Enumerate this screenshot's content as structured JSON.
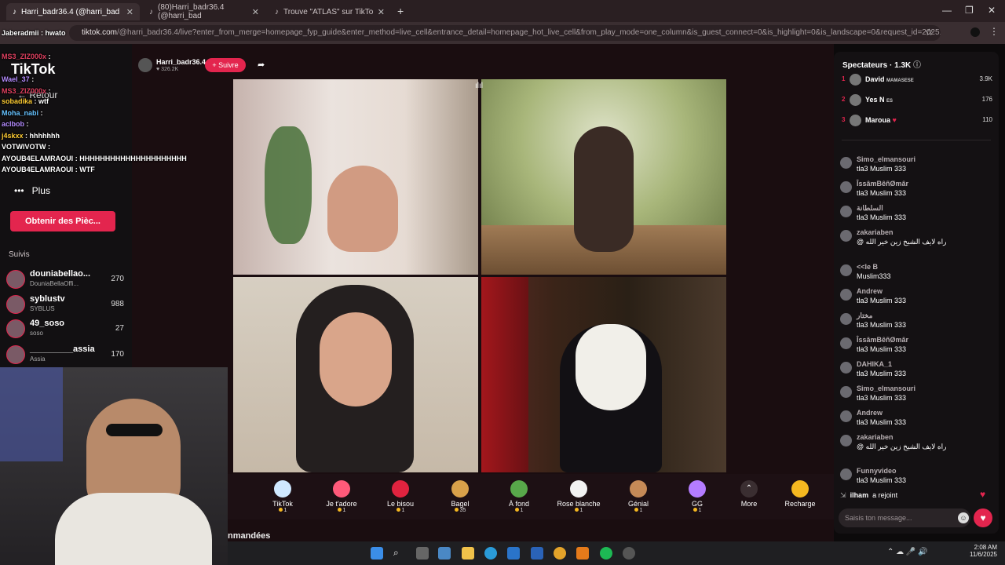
{
  "browser": {
    "tabs": [
      {
        "title": "Harri_badr36.4 (@harri_bad",
        "active": true
      },
      {
        "title": "(80)Harri_badr36.4 (@harri_bad",
        "active": false
      },
      {
        "title": "Trouve \"ATLAS\" sur TikTok | Rec",
        "active": false
      }
    ],
    "url_host": "tiktok.com",
    "url_path": "/@harri_badr36.4/live?enter_from_merge=homepage_fyp_guide&enter_method=live_cell&entrance_detail=homepage_hot_live_cell&from_play_mode=one_column&is_guest_connect=0&is_highlight=0&is_landscape=0&request_id=202511060811..."
  },
  "sidebar": {
    "logo": "TikTok",
    "back": "Retour",
    "more": "Plus",
    "coins_button": "Obtenir des Pièc...",
    "following_title": "Suivis",
    "following": [
      {
        "name": "douniabellao...",
        "sub": "DouniaBellaOffi...",
        "count": "270"
      },
      {
        "name": "syblustv",
        "sub": "SYBLUS",
        "count": "988"
      },
      {
        "name": "49_soso",
        "sub": "soso",
        "count": "27"
      },
      {
        "name": "_________assia",
        "sub": "Assia",
        "count": "170"
      }
    ]
  },
  "overlay_chat": [
    {
      "user": "Jaberadmii",
      "msg": ": hwato",
      "color": "#ffffff"
    },
    {
      "user": "MS3_ZIZ000x",
      "msg": ":",
      "color": "#e04060"
    },
    {
      "user": "Wael_37",
      "msg": ":",
      "color": "#b58cff"
    },
    {
      "user": "MS3_ZIZ000x",
      "msg": ":",
      "color": "#e04060"
    },
    {
      "user": "sobadika",
      "msg": ": wtf",
      "color": "#ffcc33"
    },
    {
      "user": "Moha_nabi",
      "msg": ":",
      "color": "#66c2ff"
    },
    {
      "user": "aclbob",
      "msg": ":",
      "color": "#b58cff"
    },
    {
      "user": "j4skxx",
      "msg": ": hhhhhhh",
      "color": "#ffcc33"
    },
    {
      "user": "VOTWIVOTW",
      "msg": ":",
      "color": "#ffffff"
    },
    {
      "user": "AYOUB4ELAMRAOUI",
      "msg": ": HHHHHHHHHHHHHHHHHHHHH",
      "color": "#ffffff"
    },
    {
      "user": "AYOUB4ELAMRAOUI",
      "msg": ": WTF",
      "color": "#ffffff"
    }
  ],
  "stream": {
    "host_name": "Harri_badr36.4",
    "host_likes": "326.2K",
    "follow_button": "+ Suivre"
  },
  "gifts": [
    {
      "name": "TikTok",
      "price": "1",
      "color": "#cfe8ff"
    },
    {
      "name": "Je t'adore",
      "price": "1",
      "color": "#ff5a7a"
    },
    {
      "name": "Le bisou",
      "price": "1",
      "color": "#e0233f"
    },
    {
      "name": "Bagel",
      "price": "35",
      "color": "#d9a14a"
    },
    {
      "name": "À fond",
      "price": "1",
      "color": "#58a84a"
    },
    {
      "name": "Rose blanche",
      "price": "1",
      "color": "#f2f2f2"
    },
    {
      "name": "Génial",
      "price": "1",
      "color": "#c58a57"
    },
    {
      "name": "GG",
      "price": "1",
      "color": "#b47cff"
    }
  ],
  "gift_more": "More",
  "recharge": "Recharge",
  "commandees": "nmandées",
  "right_panel": {
    "title": "Spectateurs",
    "count": "1.3K",
    "top": [
      {
        "rank": "1",
        "name": "David",
        "extra": "MAMASESE",
        "value": "3.9K"
      },
      {
        "rank": "2",
        "name": "Yes N",
        "extra": "ES",
        "value": "176"
      },
      {
        "rank": "3",
        "name": "Maroua",
        "extra": "",
        "value": "110"
      }
    ],
    "comments": [
      {
        "user": "Simo_elmansouri",
        "msg": "tla3 Muslim 333"
      },
      {
        "user": "ÎssâmBêñØmâr",
        "msg": "tla3 Muslim 333"
      },
      {
        "user": "السلطانة",
        "msg": "tla3 Muslim 333"
      },
      {
        "user": "zakariaben",
        "msg": "@ راه لايف الشيخ زين خير الله"
      },
      {
        "user": "<<le B",
        "msg": "Muslim333"
      },
      {
        "user": "Andrew",
        "msg": "tla3 Muslim 333"
      },
      {
        "user": "مختار",
        "msg": "tla3 Muslim 333"
      },
      {
        "user": "ÎssâmBêñØmâr",
        "msg": "tla3 Muslim 333"
      },
      {
        "user": "DAHIKA_1",
        "msg": "tla3 Muslim 333"
      },
      {
        "user": "Simo_elmansouri",
        "msg": "tla3 Muslim 333"
      },
      {
        "user": "Andrew",
        "msg": "tla3 Muslim 333"
      },
      {
        "user": "zakariaben",
        "msg": "@ راه لايف الشيخ زين خير الله"
      },
      {
        "user": "Funnyvideo",
        "msg": "tla3 Muslim 333"
      }
    ],
    "joined_user": "ilham",
    "joined_text": "a rejoint",
    "input_placeholder": "Saisis ton message..."
  },
  "taskbar": {
    "time": "2:08 AM",
    "date": "11/6/2025"
  },
  "colors": {
    "accent": "#e3254e",
    "coin": "#f5b820"
  }
}
